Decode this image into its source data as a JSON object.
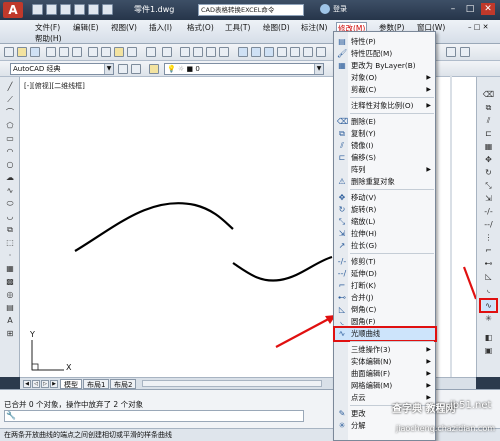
{
  "window": {
    "app_logo": "A",
    "document_title": "零件1.dwg",
    "search_placeholder": "CAD表格转换EXCEL命令",
    "login_label": "登录",
    "min": "–",
    "max": "□",
    "close": "✕"
  },
  "menubar": {
    "items": [
      "文件(F)",
      "编辑(E)",
      "视图(V)",
      "插入(I)",
      "格式(O)",
      "工具(T)",
      "绘图(D)",
      "标注(N)",
      "修改(M)",
      "参数(P)",
      "窗口(W)"
    ],
    "help": "帮助(H)"
  },
  "toolbar2": {
    "workspace": "AutoCAD 经典",
    "layer_value": "0"
  },
  "canvas": {
    "view_label": "[-][俯视][二维线框]",
    "ucs_y": "Y",
    "ucs_x": "X"
  },
  "tabs": {
    "items": [
      "模型",
      "布局1",
      "布局2"
    ]
  },
  "command": {
    "history": "已合并 0 个对象，操作中放弃了 2 个对象",
    "status": "在两条开放曲线的端点之间创建相切或平滑的样条曲线"
  },
  "modify_menu": {
    "items": [
      {
        "label": "特性(P)",
        "icon": "properties-icon"
      },
      {
        "label": "特性匹配(M)",
        "icon": "match-properties-icon"
      },
      {
        "label": "更改为 ByLayer(B)",
        "icon": "bylayer-icon"
      },
      {
        "label": "对象(O)",
        "submenu": true
      },
      {
        "label": "剪裁(C)",
        "submenu": true
      },
      {
        "label": "注释性对象比例(O)",
        "submenu": true
      },
      {
        "label": "删除(E)",
        "icon": "erase-icon"
      },
      {
        "label": "复制(Y)",
        "icon": "copy-icon"
      },
      {
        "label": "镜像(I)",
        "icon": "mirror-icon"
      },
      {
        "label": "偏移(S)",
        "icon": "offset-icon"
      },
      {
        "label": "阵列",
        "submenu": true
      },
      {
        "label": "删除重复对象",
        "icon": "delete-duplicates-icon"
      },
      {
        "label": "移动(V)",
        "icon": "move-icon"
      },
      {
        "label": "旋转(R)",
        "icon": "rotate-icon"
      },
      {
        "label": "缩放(L)",
        "icon": "scale-icon"
      },
      {
        "label": "拉伸(H)",
        "icon": "stretch-icon"
      },
      {
        "label": "拉长(G)",
        "icon": "lengthen-icon"
      },
      {
        "label": "修剪(T)",
        "icon": "trim-icon"
      },
      {
        "label": "延伸(D)",
        "icon": "extend-icon"
      },
      {
        "label": "打断(K)",
        "icon": "break-icon"
      },
      {
        "label": "合并(J)",
        "icon": "join-icon"
      },
      {
        "label": "倒角(C)",
        "icon": "chamfer-icon"
      },
      {
        "label": "圆角(F)",
        "icon": "fillet-icon"
      },
      {
        "label": "光顺曲线",
        "icon": "blend-curves-icon"
      },
      {
        "label": "三维操作(3)",
        "submenu": true
      },
      {
        "label": "实体编辑(N)",
        "submenu": true
      },
      {
        "label": "曲面编辑(F)",
        "submenu": true
      },
      {
        "label": "网格编辑(M)",
        "submenu": true
      },
      {
        "label": "点云",
        "submenu": true
      },
      {
        "label": "更改",
        "icon": "change-icon"
      },
      {
        "label": "分解",
        "icon": "explode-icon"
      }
    ]
  },
  "watermark": {
    "line1": "查字典 教程网",
    "line2": "jb51.net",
    "line3": "jiaocheng.chazidian.com"
  },
  "colors": {
    "highlight": "#e01010",
    "curve": "#000000",
    "title_bg": "#26354a"
  }
}
